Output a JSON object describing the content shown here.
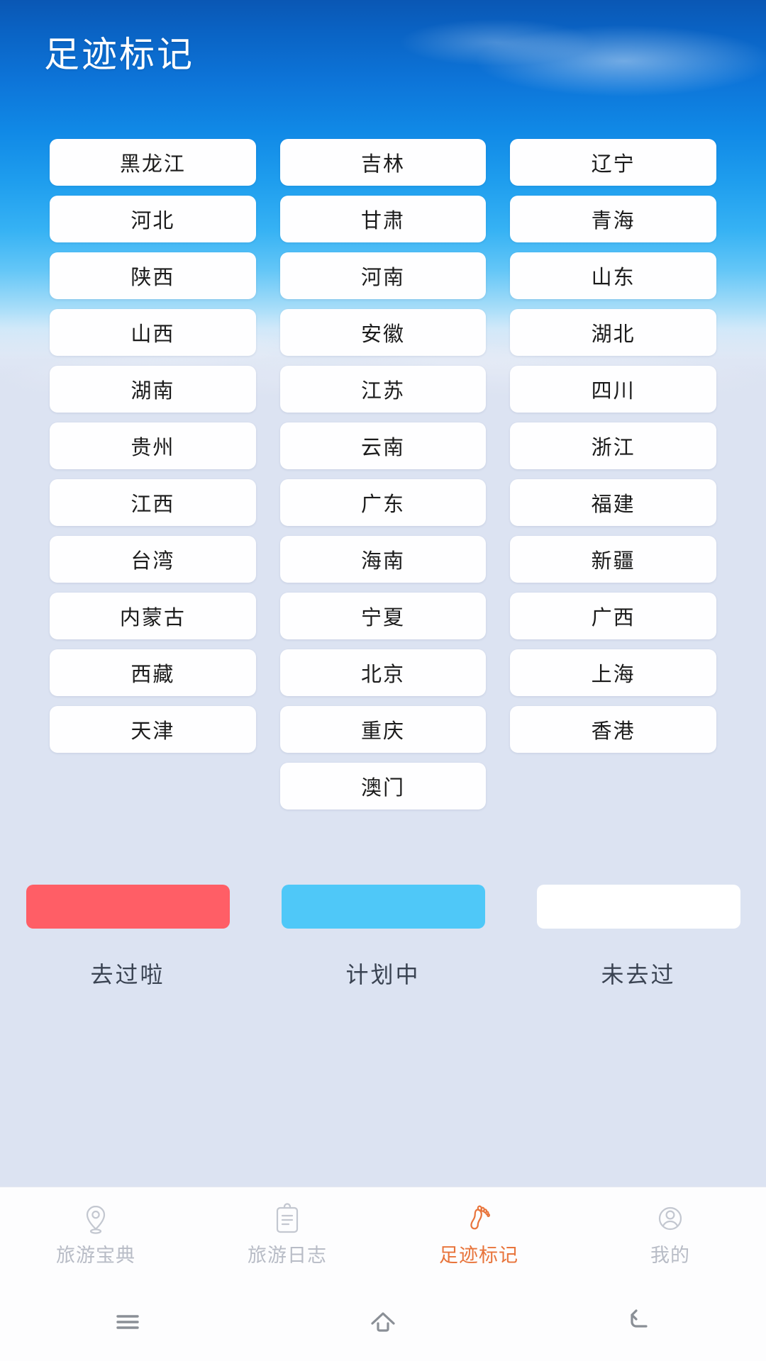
{
  "header": {
    "title": "足迹标记"
  },
  "colors": {
    "visited": "#ff5e66",
    "planned": "#4fc8f8",
    "not_visited": "#ffffff",
    "accent": "#e8743b",
    "sky_top": "#0a57b4",
    "page_bg": "#dce3f2"
  },
  "grid": {
    "columns": [
      {
        "items": [
          {
            "label": "黑龙江",
            "state": "not_visited"
          },
          {
            "label": "河北",
            "state": "not_visited"
          },
          {
            "label": "陕西",
            "state": "not_visited"
          },
          {
            "label": "山西",
            "state": "not_visited"
          },
          {
            "label": "湖南",
            "state": "not_visited"
          },
          {
            "label": "贵州",
            "state": "not_visited"
          },
          {
            "label": "江西",
            "state": "not_visited"
          },
          {
            "label": "台湾",
            "state": "not_visited"
          },
          {
            "label": "内蒙古",
            "state": "not_visited"
          },
          {
            "label": "西藏",
            "state": "not_visited"
          },
          {
            "label": "天津",
            "state": "not_visited"
          }
        ]
      },
      {
        "items": [
          {
            "label": "吉林",
            "state": "not_visited"
          },
          {
            "label": "甘肃",
            "state": "not_visited"
          },
          {
            "label": "河南",
            "state": "not_visited"
          },
          {
            "label": "安徽",
            "state": "not_visited"
          },
          {
            "label": "江苏",
            "state": "not_visited"
          },
          {
            "label": "云南",
            "state": "not_visited"
          },
          {
            "label": "广东",
            "state": "not_visited"
          },
          {
            "label": "海南",
            "state": "not_visited"
          },
          {
            "label": "宁夏",
            "state": "not_visited"
          },
          {
            "label": "北京",
            "state": "not_visited"
          },
          {
            "label": "重庆",
            "state": "not_visited"
          },
          {
            "label": "澳门",
            "state": "not_visited"
          }
        ]
      },
      {
        "items": [
          {
            "label": "辽宁",
            "state": "not_visited"
          },
          {
            "label": "青海",
            "state": "not_visited"
          },
          {
            "label": "山东",
            "state": "not_visited"
          },
          {
            "label": "湖北",
            "state": "not_visited"
          },
          {
            "label": "四川",
            "state": "not_visited"
          },
          {
            "label": "浙江",
            "state": "not_visited"
          },
          {
            "label": "福建",
            "state": "not_visited"
          },
          {
            "label": "新疆",
            "state": "not_visited"
          },
          {
            "label": "广西",
            "state": "not_visited"
          },
          {
            "label": "上海",
            "state": "not_visited"
          },
          {
            "label": "香港",
            "state": "not_visited"
          }
        ]
      }
    ]
  },
  "legend": {
    "items": [
      {
        "label": "去过啦",
        "swatch": "red"
      },
      {
        "label": "计划中",
        "swatch": "blue"
      },
      {
        "label": "未去过",
        "swatch": "white"
      }
    ]
  },
  "tabbar": {
    "items": [
      {
        "label": "旅游宝典",
        "icon": "map-pin-icon",
        "active": false
      },
      {
        "label": "旅游日志",
        "icon": "clipboard-icon",
        "active": false
      },
      {
        "label": "足迹标记",
        "icon": "footprint-icon",
        "active": true
      },
      {
        "label": "我的",
        "icon": "person-icon",
        "active": false
      }
    ]
  },
  "system_nav": {
    "items": [
      {
        "icon": "recents-icon"
      },
      {
        "icon": "home-icon"
      },
      {
        "icon": "back-icon"
      }
    ]
  }
}
